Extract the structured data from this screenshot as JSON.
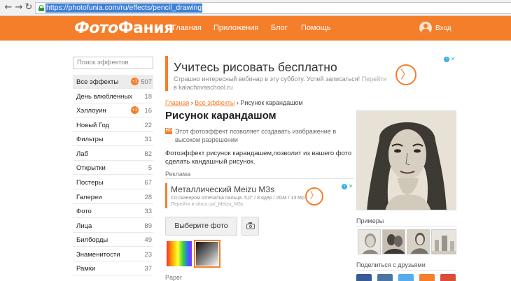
{
  "browser": {
    "url": "https://photofunia.com/ru/effects/pencil_drawing"
  },
  "header": {
    "logo_part1": "Фото",
    "logo_part2": "Фания",
    "nav": [
      "Главная",
      "Приложения",
      "Блог",
      "Помощь"
    ],
    "login": "Вход"
  },
  "sidebar": {
    "search_placeholder": "Поиск эффектов",
    "categories": [
      {
        "label": "Все эффекты",
        "count": "507",
        "badge": "+1"
      },
      {
        "label": "День влюбленных",
        "count": "18",
        "badge": ""
      },
      {
        "label": "Хэллоуин",
        "count": "16",
        "badge": "+1"
      },
      {
        "label": "Новый Год",
        "count": "22",
        "badge": ""
      },
      {
        "label": "Фильтры",
        "count": "31",
        "badge": ""
      },
      {
        "label": "Лаб",
        "count": "82",
        "badge": ""
      },
      {
        "label": "Открытки",
        "count": "5",
        "badge": ""
      },
      {
        "label": "Постеры",
        "count": "67",
        "badge": ""
      },
      {
        "label": "Галереи",
        "count": "28",
        "badge": ""
      },
      {
        "label": "Фото",
        "count": "33",
        "badge": ""
      },
      {
        "label": "Лица",
        "count": "89",
        "badge": ""
      },
      {
        "label": "Билборды",
        "count": "49",
        "badge": ""
      },
      {
        "label": "Знаменитости",
        "count": "23",
        "badge": ""
      },
      {
        "label": "Рамки",
        "count": "37",
        "badge": ""
      }
    ]
  },
  "ad_top": {
    "title": "Учитесь рисовать бесплатно",
    "description": "Страшно интересный вебинар в эту субботу. Успей записаться!",
    "more": "Перейти",
    "url": "в kalachovaschool.ru",
    "arrow": "〉"
  },
  "main": {
    "breadcrumb_home": "Главная",
    "breadcrumb_sep": "›",
    "breadcrumb_all": "Все эффекты",
    "breadcrumb_current": "Рисунок карандашом",
    "title": "Рисунок карандашом",
    "hd_badge": "HD",
    "hd_text": "Этот фотоэффект позволяет создавать изображение в высоком разрешении",
    "description": "Фотоэффект рисунок карандашем,позволит из вашего фото сделать кандашный рисунок.",
    "ad_label": "Реклама",
    "choose_button": "Выберите фото",
    "paper_label": "Paper"
  },
  "ad_middle": {
    "title": "Металлический Meizu M3s",
    "description": "Со сканером отпечатка пальца. 5,0\" / 8 ядер / 2GM / 13 Мр",
    "url": "Перейти в citrus.ua/_Meizu_M3s",
    "arrow": "〉"
  },
  "ad_marks": {
    "info": "i",
    "close": "✕"
  },
  "right": {
    "examples_label": "Примеры",
    "share_label": "Поделиться с друзьями"
  },
  "colors": {
    "brand_orange": "#f57e2a",
    "share": [
      "#3b5998",
      "#4c75a3",
      "#55acee",
      "#f57e2a",
      "#dd4b39"
    ]
  }
}
